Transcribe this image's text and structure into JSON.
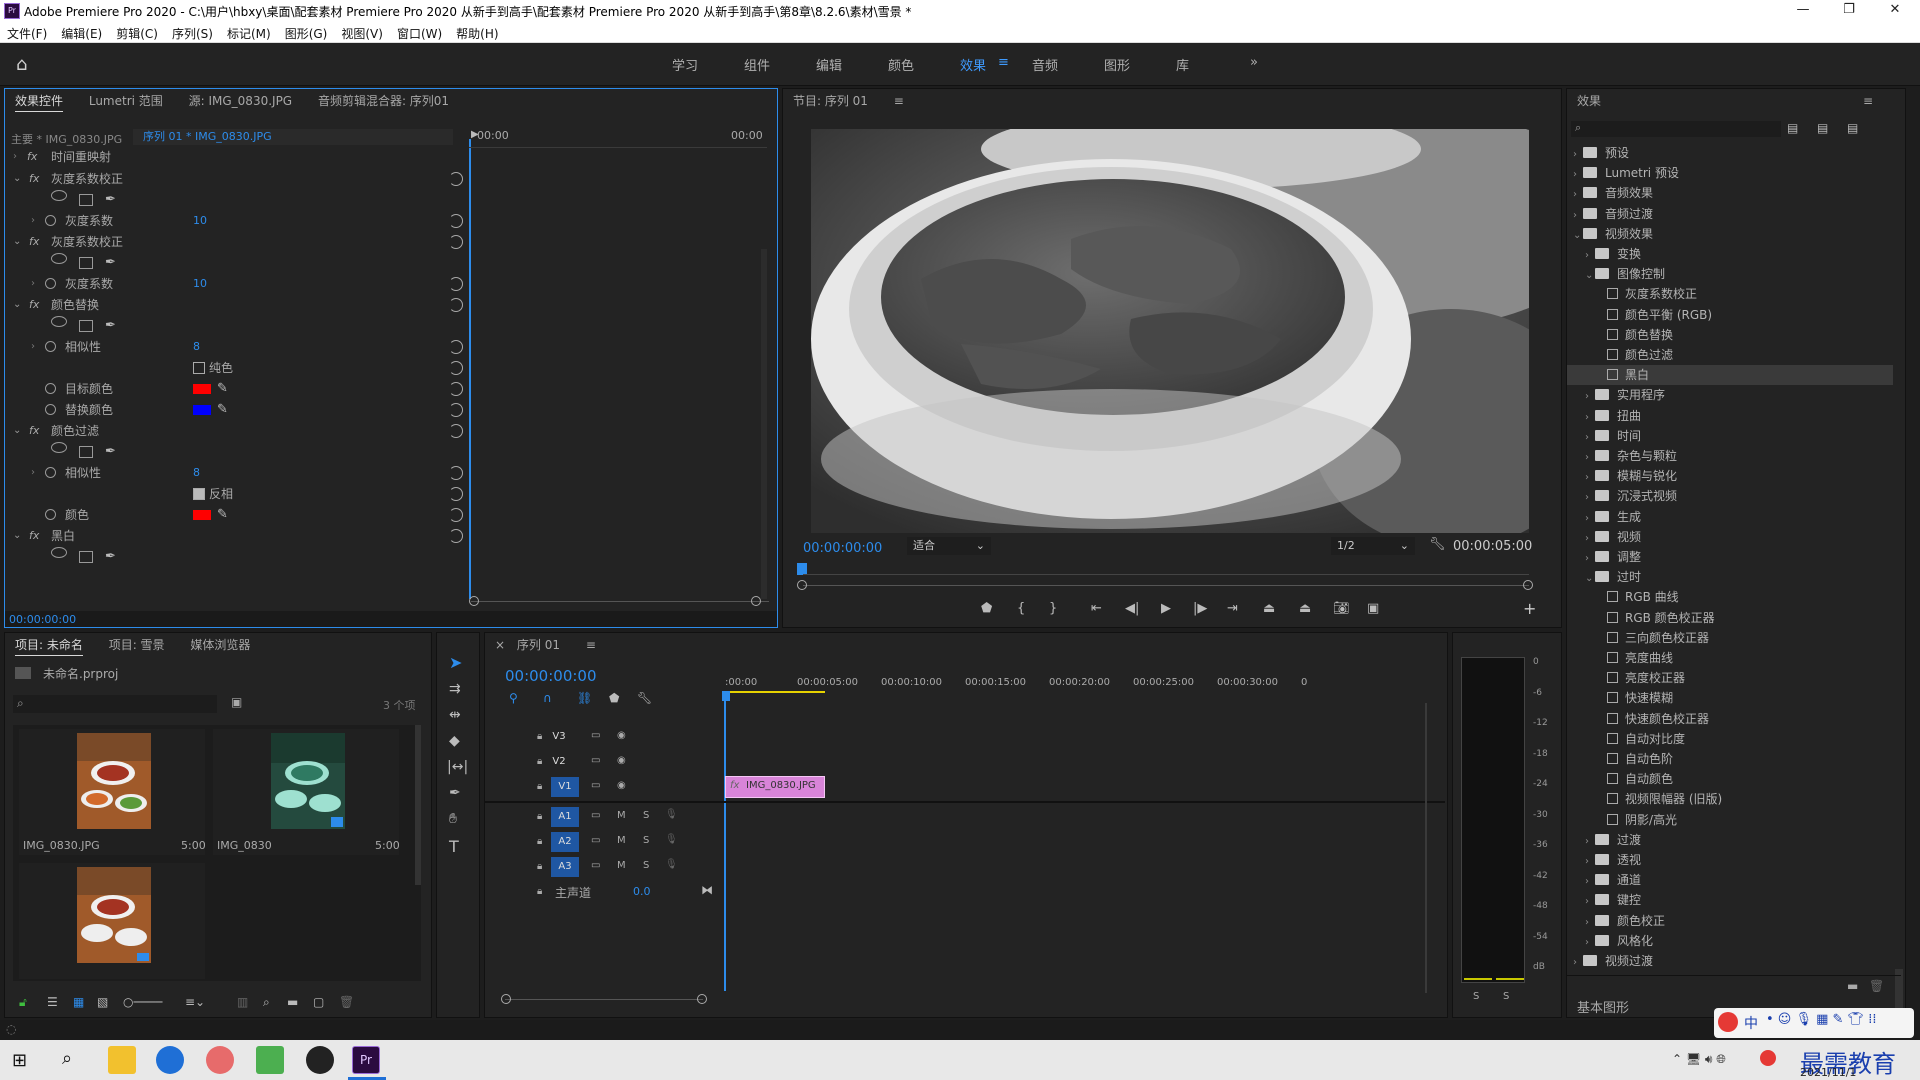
{
  "titlebar": {
    "title": "Adobe Premiere Pro 2020 - C:\\用户\\hbxy\\桌面\\配套素材 Premiere Pro 2020 从新手到高手\\配套素材 Premiere Pro 2020 从新手到高手\\第8章\\8.2.6\\素材\\雪景 *",
    "minimize": "—",
    "maximize": "❐",
    "close": "✕"
  },
  "menu": [
    "文件(F)",
    "编辑(E)",
    "剪辑(C)",
    "序列(S)",
    "标记(M)",
    "图形(G)",
    "视图(V)",
    "窗口(W)",
    "帮助(H)"
  ],
  "workspaces": {
    "tabs": [
      "学习",
      "组件",
      "编辑",
      "颜色",
      "效果",
      "音频",
      "图形",
      "库"
    ],
    "active": "效果",
    "more": "»"
  },
  "effect_controls": {
    "tabs": [
      "效果控件",
      "Lumetri 范围",
      "源: IMG_0830.JPG",
      "音频剪辑混合器: 序列01"
    ],
    "master": "主要 * IMG_0830.JPG",
    "sequence_clip": "序列 01 * IMG_0830.JPG",
    "time_start": "00:00",
    "time_end": "00:00",
    "footer_time": "00:00:00:00",
    "rows": [
      {
        "label": "时间重映射",
        "type": "group"
      },
      {
        "label": "灰度系数校正",
        "type": "fx"
      },
      {
        "type": "masks"
      },
      {
        "label": "灰度系数",
        "type": "param",
        "value": "10"
      },
      {
        "label": "灰度系数校正",
        "type": "fx"
      },
      {
        "type": "masks"
      },
      {
        "label": "灰度系数",
        "type": "param",
        "value": "10"
      },
      {
        "label": "颜色替换",
        "type": "fx"
      },
      {
        "type": "masks"
      },
      {
        "label": "相似性",
        "type": "param",
        "value": "8"
      },
      {
        "label": "纯色",
        "type": "check",
        "checked": false
      },
      {
        "label": "目标颜色",
        "type": "color",
        "color": "#ff0000"
      },
      {
        "label": "替换颜色",
        "type": "color",
        "color": "#0000ff"
      },
      {
        "label": "颜色过滤",
        "type": "fx"
      },
      {
        "type": "masks"
      },
      {
        "label": "相似性",
        "type": "param",
        "value": "8"
      },
      {
        "label": "反相",
        "type": "check",
        "checked": true
      },
      {
        "label": "颜色",
        "type": "color",
        "color": "#ff0000"
      },
      {
        "label": "黑白",
        "type": "fx"
      },
      {
        "type": "masks"
      }
    ]
  },
  "program_monitor": {
    "title": "节目: 序列 01",
    "timecode": "00:00:00:00",
    "fit": "适合",
    "resolution": "1/2",
    "duration": "00:00:05:00"
  },
  "effects_panel": {
    "title": "效果",
    "items": [
      {
        "label": "预设",
        "level": 0,
        "kind": "folder",
        "open": false
      },
      {
        "label": "Lumetri 预设",
        "level": 0,
        "kind": "folder",
        "open": false
      },
      {
        "label": "音频效果",
        "level": 0,
        "kind": "folder",
        "open": false
      },
      {
        "label": "音频过渡",
        "level": 0,
        "kind": "folder",
        "open": false
      },
      {
        "label": "视频效果",
        "level": 0,
        "kind": "folder",
        "open": true
      },
      {
        "label": "变换",
        "level": 1,
        "kind": "folder",
        "open": false
      },
      {
        "label": "图像控制",
        "level": 1,
        "kind": "folder",
        "open": true
      },
      {
        "label": "灰度系数校正",
        "level": 2,
        "kind": "effect"
      },
      {
        "label": "颜色平衡 (RGB)",
        "level": 2,
        "kind": "effect"
      },
      {
        "label": "颜色替换",
        "level": 2,
        "kind": "effect"
      },
      {
        "label": "颜色过滤",
        "level": 2,
        "kind": "effect"
      },
      {
        "label": "黑白",
        "level": 2,
        "kind": "effect",
        "selected": true
      },
      {
        "label": "实用程序",
        "level": 1,
        "kind": "folder",
        "open": false
      },
      {
        "label": "扭曲",
        "level": 1,
        "kind": "folder",
        "open": false
      },
      {
        "label": "时间",
        "level": 1,
        "kind": "folder",
        "open": false
      },
      {
        "label": "杂色与颗粒",
        "level": 1,
        "kind": "folder",
        "open": false
      },
      {
        "label": "模糊与锐化",
        "level": 1,
        "kind": "folder",
        "open": false
      },
      {
        "label": "沉浸式视频",
        "level": 1,
        "kind": "folder",
        "open": false
      },
      {
        "label": "生成",
        "level": 1,
        "kind": "folder",
        "open": false
      },
      {
        "label": "视频",
        "level": 1,
        "kind": "folder",
        "open": false
      },
      {
        "label": "调整",
        "level": 1,
        "kind": "folder",
        "open": false
      },
      {
        "label": "过时",
        "level": 1,
        "kind": "folder",
        "open": true
      },
      {
        "label": "RGB 曲线",
        "level": 2,
        "kind": "effect"
      },
      {
        "label": "RGB 颜色校正器",
        "level": 2,
        "kind": "effect"
      },
      {
        "label": "三向颜色校正器",
        "level": 2,
        "kind": "effect"
      },
      {
        "label": "亮度曲线",
        "level": 2,
        "kind": "effect"
      },
      {
        "label": "亮度校正器",
        "level": 2,
        "kind": "effect"
      },
      {
        "label": "快速模糊",
        "level": 2,
        "kind": "effect"
      },
      {
        "label": "快速颜色校正器",
        "level": 2,
        "kind": "effect"
      },
      {
        "label": "自动对比度",
        "level": 2,
        "kind": "effect"
      },
      {
        "label": "自动色阶",
        "level": 2,
        "kind": "effect"
      },
      {
        "label": "自动颜色",
        "level": 2,
        "kind": "effect"
      },
      {
        "label": "视频限幅器 (旧版)",
        "level": 2,
        "kind": "effect"
      },
      {
        "label": "阴影/高光",
        "level": 2,
        "kind": "effect"
      },
      {
        "label": "过渡",
        "level": 1,
        "kind": "folder",
        "open": false
      },
      {
        "label": "透视",
        "level": 1,
        "kind": "folder",
        "open": false
      },
      {
        "label": "通道",
        "level": 1,
        "kind": "folder",
        "open": false
      },
      {
        "label": "键控",
        "level": 1,
        "kind": "folder",
        "open": false
      },
      {
        "label": "颜色校正",
        "level": 1,
        "kind": "folder",
        "open": false
      },
      {
        "label": "风格化",
        "level": 1,
        "kind": "folder",
        "open": false
      },
      {
        "label": "视频过渡",
        "level": 0,
        "kind": "folder",
        "open": false
      }
    ],
    "footer": "基本图形"
  },
  "project_panel": {
    "tabs": [
      "项目: 未命名",
      "项目: 雪景",
      "媒体浏览器"
    ],
    "file": "未命名.prproj",
    "count": "3 个项",
    "items": [
      {
        "name": "IMG_0830.JPG",
        "duration": "5:00"
      },
      {
        "name": "IMG_0830",
        "duration": "5:00"
      },
      {
        "name": "",
        "duration": ""
      }
    ]
  },
  "timeline": {
    "title": "序列 01",
    "timecode": "00:00:00:00",
    "ruler": [
      ":00:00",
      "00:00:05:00",
      "00:00:10:00",
      "00:00:15:00",
      "00:00:20:00",
      "00:00:25:00",
      "00:00:30:00",
      "0"
    ],
    "video_tracks": [
      "V3",
      "V2",
      "V1"
    ],
    "audio_tracks": [
      "A1",
      "A2",
      "A3"
    ],
    "master": "主声道",
    "master_value": "0.0",
    "clip": "IMG_0830.JPG"
  },
  "audio_meter": {
    "scale": [
      "0",
      "-6",
      "-12",
      "-18",
      "-24",
      "-30",
      "-36",
      "-42",
      "-48",
      "-54",
      "dB"
    ],
    "solo": [
      "S",
      "S"
    ]
  },
  "taskbar": {
    "ime": "中",
    "date": "2021/11/1",
    "watermark": "最需教育"
  }
}
